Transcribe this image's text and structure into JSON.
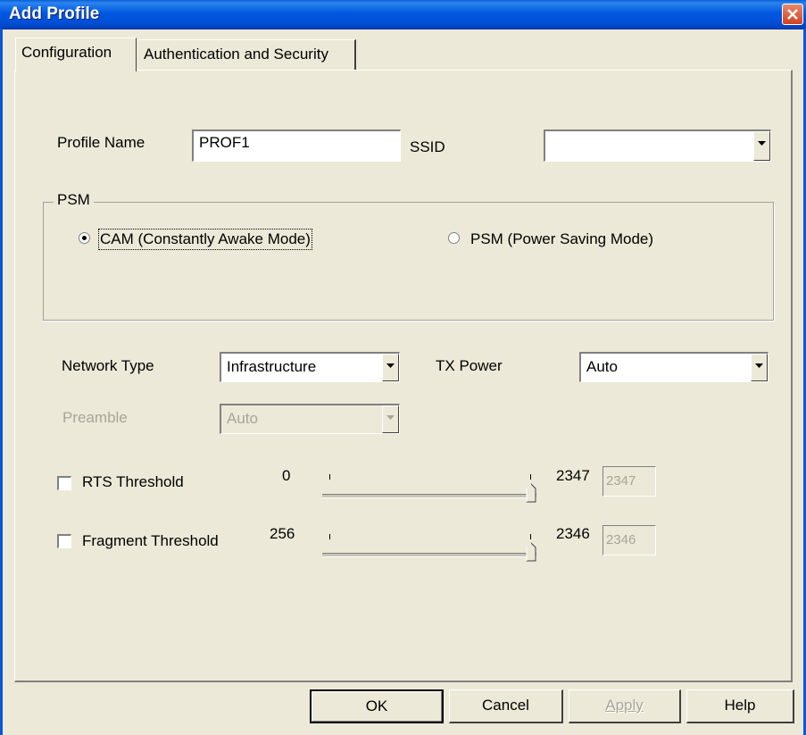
{
  "window": {
    "title": "Add Profile"
  },
  "tabs": [
    {
      "label": "Configuration",
      "active": true
    },
    {
      "label": "Authentication and Security",
      "active": false
    }
  ],
  "profile": {
    "name_label": "Profile Name",
    "name_value": "PROF1",
    "ssid_label": "SSID",
    "ssid_value": ""
  },
  "psm": {
    "group_title": "PSM",
    "options": [
      {
        "label": "CAM (Constantly Awake Mode)",
        "selected": true
      },
      {
        "label": "PSM (Power Saving Mode)",
        "selected": false
      }
    ]
  },
  "network": {
    "type_label": "Network Type",
    "type_value": "Infrastructure",
    "tx_label": "TX Power",
    "tx_value": "Auto",
    "preamble_label": "Preamble",
    "preamble_value": "Auto"
  },
  "rts": {
    "label": "RTS Threshold",
    "checked": false,
    "min": "0",
    "max": "2347",
    "value": "2347",
    "level": 1.0
  },
  "fragment": {
    "label": "Fragment Threshold",
    "checked": false,
    "min": "256",
    "max": "2346",
    "value": "2346",
    "level": 1.0
  },
  "buttons": {
    "ok": "OK",
    "cancel": "Cancel",
    "apply": "Apply",
    "help": "Help"
  },
  "colors": {
    "titlebar": "#0058e0",
    "dialog_bg": "#ece9d8",
    "close_button": "#d2411f",
    "disabled_text": "#a8a598"
  }
}
